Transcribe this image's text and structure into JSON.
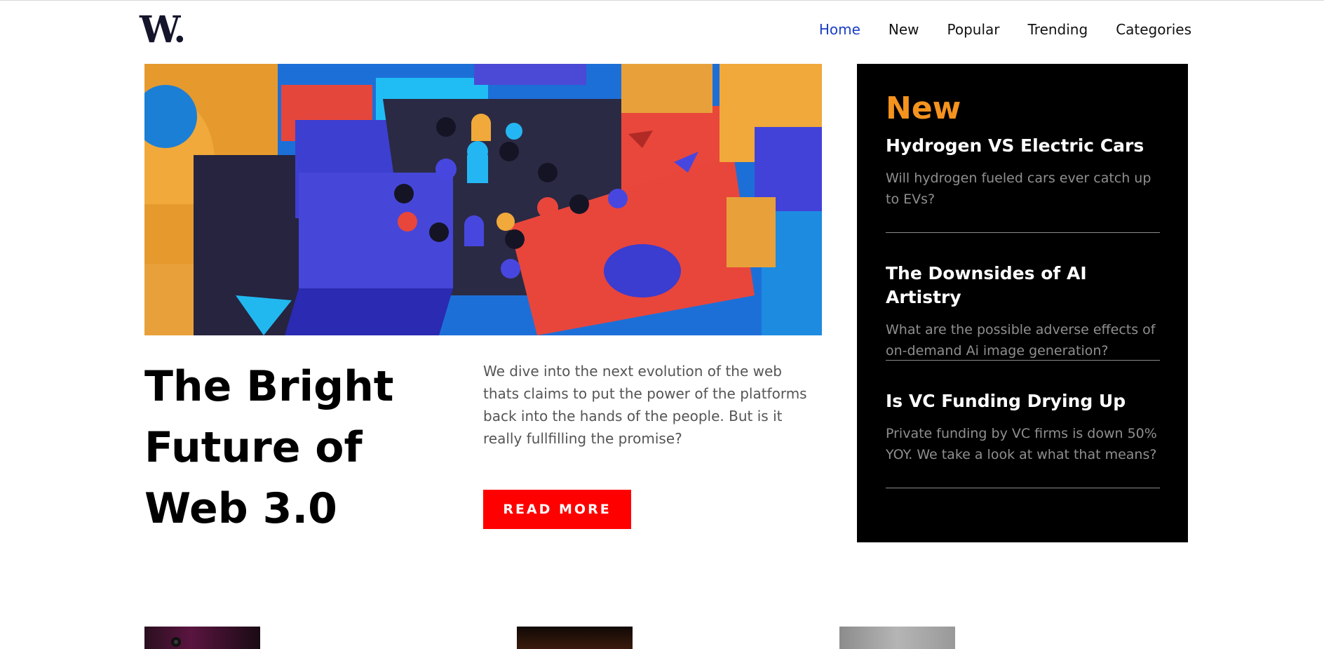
{
  "header": {
    "logo": "W.",
    "nav": [
      {
        "label": "Home",
        "active": true
      },
      {
        "label": "New",
        "active": false
      },
      {
        "label": "Popular",
        "active": false
      },
      {
        "label": "Trending",
        "active": false
      },
      {
        "label": "Categories",
        "active": false
      }
    ]
  },
  "hero": {
    "image": "colorful-3d-blocks-image",
    "title": "The Bright Future of Web 3.0",
    "description": "We dive into the next evolution of the web thats claims to put the power of the platforms back into the hands of the people. But is it really fullfilling the promise?",
    "cta_label": "READ MORE",
    "cta_color": "#ff0000"
  },
  "new_panel": {
    "heading": "New",
    "heading_color": "#f5931e",
    "items": [
      {
        "title": "Hydrogen VS Electric Cars",
        "summary": "Will hydrogen fueled cars ever catch up to EVs?"
      },
      {
        "title": "The Downsides of AI Artistry",
        "summary": "What are the possible adverse effects of on-demand Ai image generation?"
      },
      {
        "title": "Is VC Funding Drying Up",
        "summary": "Private funding by VC firms is down 50% YOY. We take a look at what that means?"
      }
    ]
  },
  "thumbnails": [
    {
      "image": "dark-magenta-thumbnail"
    },
    {
      "image": "dark-orange-thumbnail"
    },
    {
      "image": "gray-thumbnail"
    }
  ],
  "colors": {
    "accent_blue": "#1a3fc4",
    "panel_bg": "#000000",
    "logo": "#14142b"
  }
}
